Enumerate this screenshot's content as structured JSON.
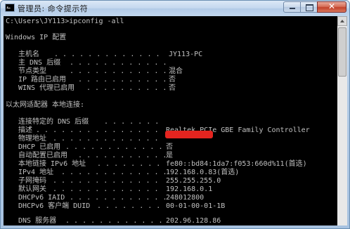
{
  "window": {
    "title": "管理员: 命令提示符",
    "icon": "cmd-icon",
    "controls": {
      "minimize": "minimize-icon",
      "maximize": "maximize-icon",
      "close": "close-icon",
      "close_glyph": "✕"
    }
  },
  "console": {
    "prompt_line": "C:\\Users\\JY113>ipconfig -all",
    "header": "Windows IP 配置",
    "host_section": [
      {
        "label": "主机名",
        "dots": ". . . . . . . . . . . . .",
        "value": "JY113-PC"
      },
      {
        "label": "主 DNS 后缀",
        "dots": ". . . . . . . . . . . .",
        "value": ""
      },
      {
        "label": "节点类型",
        "dots": ". . . . . . . . . . . .",
        "value": "混合"
      },
      {
        "label": "IP 路由已启用",
        "dots": ". . . . . . . . . . .",
        "value": "否"
      },
      {
        "label": "WINS 代理已启用",
        "dots": ". . . . . . . . . .",
        "value": "否"
      }
    ],
    "adapter_header": "以太网适配器 本地连接:",
    "adapter_section": [
      {
        "label": "连接特定的 DNS 后缀",
        "dots": ". . . . . . .",
        "value": ""
      },
      {
        "label": "描述",
        "dots": ". . . . . . . . . . . . . . .",
        "value": "Realtek PCIe GBE Family Controller"
      },
      {
        "label": "物理地址",
        "dots": ". . . . . . . . . . . . .",
        "value": ""
      },
      {
        "label": "DHCP 已启用",
        "dots": ". . . . . . . . . . . .",
        "value": "否"
      },
      {
        "label": "自动配置已启用",
        "dots": ". . . . . . . . . . .",
        "value": "是"
      },
      {
        "label": "本地链接 IPv6 地址",
        "dots": ". . . . . . . .",
        "value": "fe80::bd84:1da7:f053:660d%11(首选)"
      },
      {
        "label": "IPv4 地址",
        "dots": ". . . . . . . . . . . . .",
        "value": "192.168.0.83(首选)"
      },
      {
        "label": "子网掩码",
        "dots": ". . . . . . . . . . . . .",
        "value": "255.255.255.0"
      },
      {
        "label": "默认网关",
        "dots": ". . . . . . . . . . . . .",
        "value": "192.168.0.1"
      },
      {
        "label": "DHCPv6 IAID",
        "dots": ". . . . . . . . . . . .",
        "value": "248012800"
      },
      {
        "label": "DHCPv6 客户端 DUID",
        "dots": ". . . . . . . .",
        "value": "00-01-00-01-1B"
      }
    ],
    "dns_line": {
      "label": "DNS 服务器",
      "dots": ". . . . . . . . . . . .",
      "value": "202.96.128.86"
    }
  },
  "colors": {
    "console_bg": "#000000",
    "console_text": "#c0c0c0",
    "redaction": "#e4241f",
    "title_bar": "#c3d7ee",
    "close_button": "#c3422b"
  }
}
